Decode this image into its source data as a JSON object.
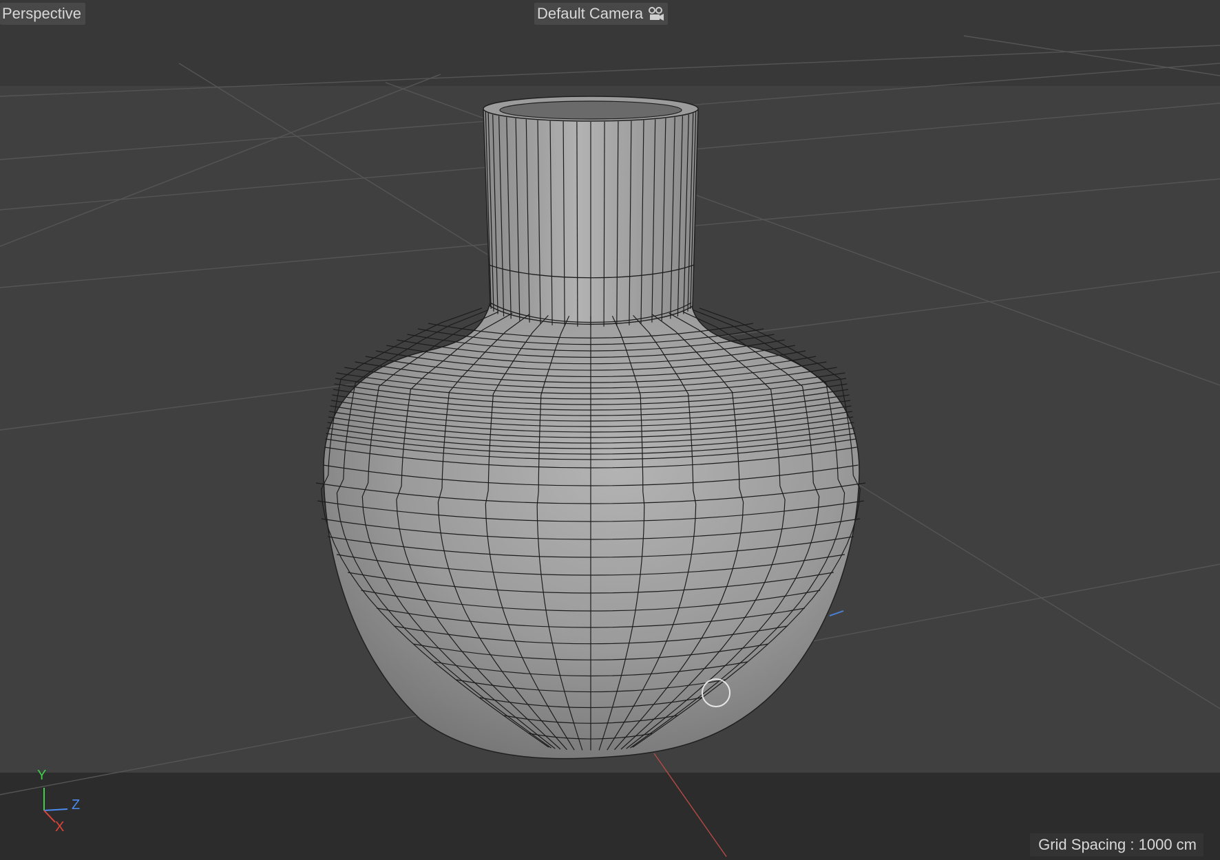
{
  "viewport": {
    "view_name": "Perspective",
    "camera_name": "Default Camera",
    "camera_icon": "camera-icon",
    "grid_spacing": "Grid Spacing : 1000 cm",
    "background": "#3f3f3f",
    "horizon_band": "#383838",
    "floor_band": "#2a2a2a"
  },
  "axis_gizmo": {
    "y_label": "Y",
    "z_label": "Z",
    "x_label": "X",
    "y_color": "#3fcf4a",
    "z_color": "#4a8cf0",
    "x_color": "#e0453b"
  },
  "model": {
    "name": "vase",
    "shading": "gouraud-lines",
    "surface_color": "#9a9a9a",
    "wire_color": "#1a1a1a"
  },
  "cursor": {
    "icon": "circle-cursor-icon"
  }
}
